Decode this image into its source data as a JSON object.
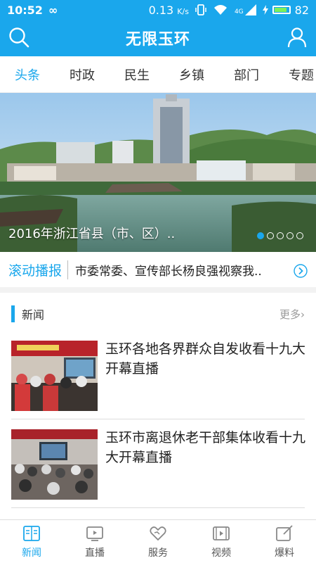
{
  "status_bar": {
    "time": "10:52",
    "inf_symbol": "∞",
    "net_speed": "0.13",
    "net_unit": "K/s",
    "network": "4G",
    "battery": "82"
  },
  "header": {
    "title": "无限玉环",
    "search_icon": "search-icon",
    "user_icon": "user-icon"
  },
  "tabs": [
    {
      "label": "头条",
      "active": true
    },
    {
      "label": "时政"
    },
    {
      "label": "民生"
    },
    {
      "label": "乡镇"
    },
    {
      "label": "部门"
    },
    {
      "label": "专题"
    }
  ],
  "banner": {
    "caption": "2016年浙江省县（市、区）..",
    "slide_count": 5,
    "active_slide": 1
  },
  "ticker": {
    "label": "滚动播报",
    "text": "市委常委、宣传部长杨良强视察我.."
  },
  "section": {
    "name": "新闻",
    "more": "更多"
  },
  "news": [
    {
      "headline": "玉环各地各界群众自发收看十九大开幕直播"
    },
    {
      "headline": "玉环市离退休老干部集体收看十九大开幕直播"
    }
  ],
  "bottom_nav": [
    {
      "label": "新闻",
      "icon": "news-icon",
      "active": true
    },
    {
      "label": "直播",
      "icon": "live-tv-icon"
    },
    {
      "label": "服务",
      "icon": "heart-icon"
    },
    {
      "label": "视频",
      "icon": "video-icon"
    },
    {
      "label": "爆料",
      "icon": "edit-icon"
    }
  ],
  "colors": {
    "accent": "#1aa7ec",
    "text": "#222222",
    "muted": "#999999"
  }
}
